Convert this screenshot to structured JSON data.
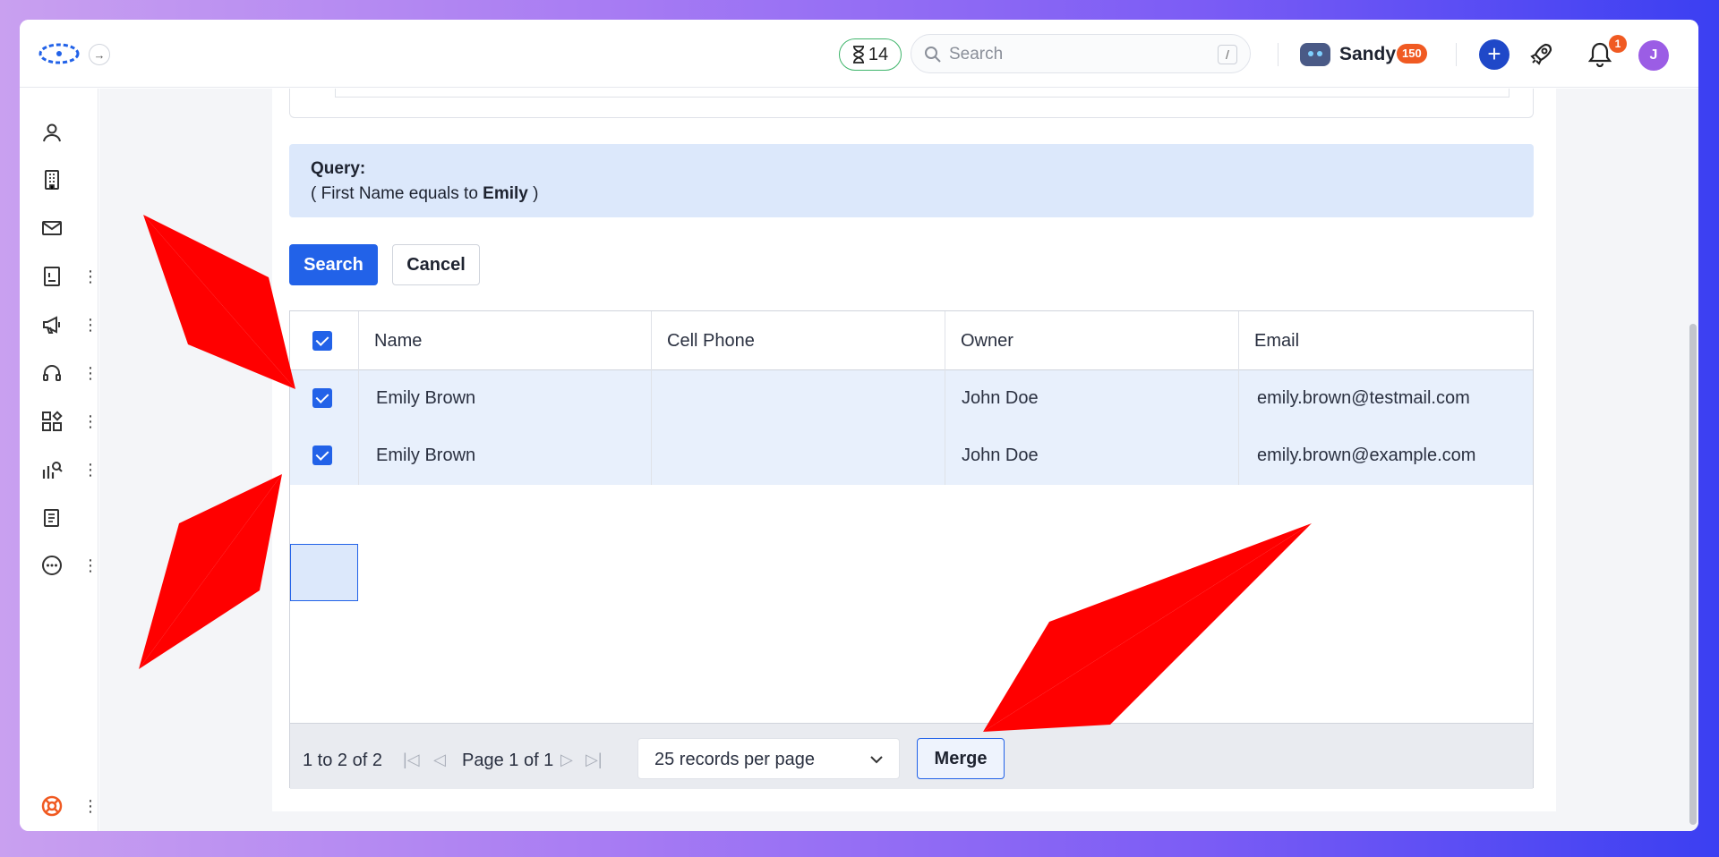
{
  "topbar": {
    "timer_count": "14",
    "search_placeholder": "Search",
    "search_shortcut": "/",
    "user_name": "Sandy",
    "points": "150",
    "notification_count": "1",
    "avatar_initial": "J"
  },
  "sidebar": {
    "items": [
      {
        "icon": "person-icon"
      },
      {
        "icon": "building-icon"
      },
      {
        "icon": "mail-icon"
      },
      {
        "icon": "contact-book-icon"
      },
      {
        "icon": "megaphone-icon"
      },
      {
        "icon": "headset-icon"
      },
      {
        "icon": "apps-icon"
      },
      {
        "icon": "analytics-icon"
      },
      {
        "icon": "document-icon"
      },
      {
        "icon": "more-icon"
      },
      {
        "icon": "help-lifebuoy-icon"
      }
    ]
  },
  "query": {
    "title": "Query:",
    "prefix": "( First Name equals to ",
    "value": "Emily",
    "suffix": " )"
  },
  "actions": {
    "search_label": "Search",
    "cancel_label": "Cancel"
  },
  "table": {
    "columns": [
      "Name",
      "Cell Phone",
      "Owner",
      "Email"
    ],
    "rows": [
      {
        "name": "Emily Brown",
        "cell_phone": "",
        "owner": "John Doe",
        "email": "emily.brown@testmail.com",
        "selected": true
      },
      {
        "name": "Emily Brown",
        "cell_phone": "",
        "owner": "John Doe",
        "email": "emily.brown@example.com",
        "selected": true
      }
    ]
  },
  "pager": {
    "range": "1 to 2 of 2",
    "page_label": "Page 1 of 1",
    "per_page": "25 records per page",
    "merge_label": "Merge"
  },
  "colors": {
    "accent": "#2262e8",
    "arrow": "#ff0000",
    "badge": "#f05a22"
  }
}
